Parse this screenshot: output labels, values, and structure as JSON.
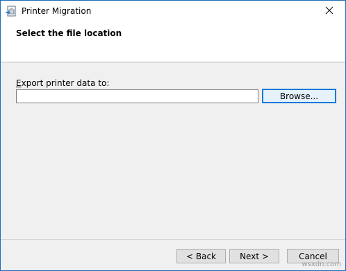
{
  "window": {
    "title": "Printer Migration",
    "icon": "printer-migration-icon",
    "close_icon": "close-icon"
  },
  "header": {
    "title": "Select the file location"
  },
  "form": {
    "label": "Export printer data to:",
    "label_mnemonic": "E",
    "path_value": "",
    "browse_label": "Browse..."
  },
  "buttons": {
    "back": "< Back",
    "next": "Next >",
    "cancel": "Cancel"
  },
  "watermark": "wsxdn.com",
  "colors": {
    "focus_border": "#0078d7",
    "window_border": "#1e6bb8",
    "dialog_bg": "#f0f0f0"
  }
}
